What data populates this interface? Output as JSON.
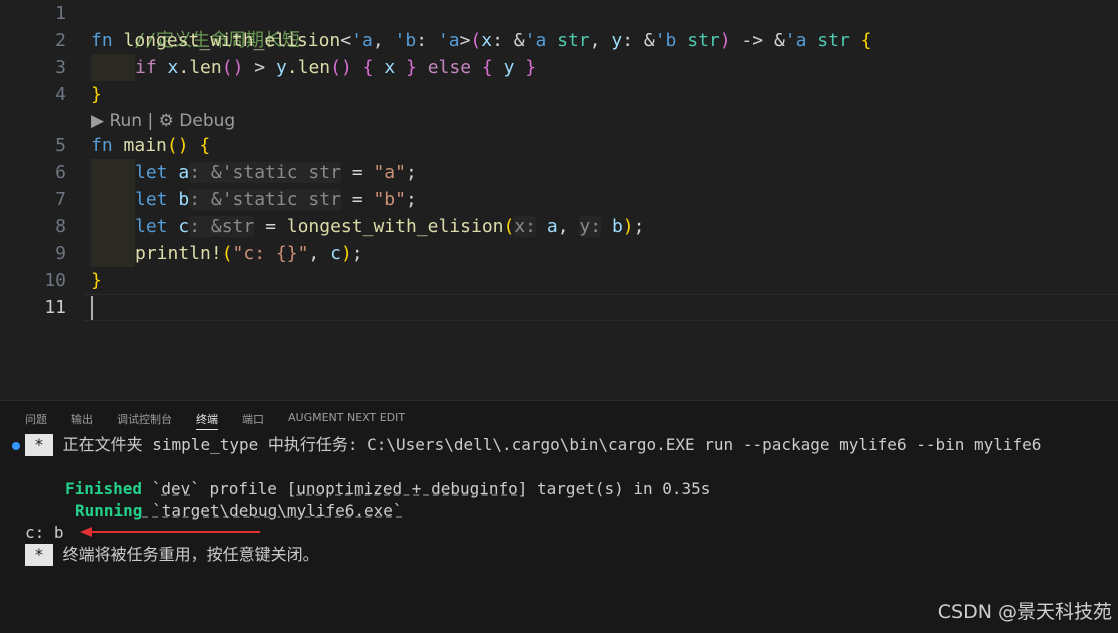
{
  "editor": {
    "line_numbers": [
      "1",
      "2",
      "3",
      "4",
      "5",
      "6",
      "7",
      "8",
      "9",
      "10",
      "11"
    ],
    "codelens": {
      "run": "▶ Run",
      "sep": " | ",
      "debug": "⚙ Debug"
    },
    "lines": {
      "l1": "//定义生命周期长短",
      "l2_fn": "fn",
      "l2_name": "longest_with_elision",
      "l2_rest_a": "<",
      "l2_lt_a": "'a",
      "l2_comma1": ", ",
      "l2_lt_b": "'b",
      "l2_colon": ": ",
      "l2_lt_a2": "'a",
      "l2_gt": ">",
      "l2_paren_open": "(",
      "l2_x": "x",
      "l2_xcolon": ": &",
      "l2_xlt": "'a",
      "l2_xty": " str",
      "l2_comma2": ", ",
      "l2_y": "y",
      "l2_ycolon": ": &",
      "l2_ylt": "'b",
      "l2_yty": " str",
      "l2_paren_close": ")",
      "l2_arrow": " -> &",
      "l2_rlt": "'a",
      "l2_rty": " str",
      "l2_brace": " {",
      "l3_if": "if",
      "l3_x": "x",
      "l3_len1": ".len",
      "l3_pp1": "()",
      "l3_gt": " > ",
      "l3_y": "y",
      "l3_len2": ".len",
      "l3_pp2": "()",
      "l3_b1": " { ",
      "l3_x2": "x",
      "l3_b2": " }",
      "l3_else": " else",
      "l3_b3": " { ",
      "l3_y2": "y",
      "l3_b4": " }",
      "l4": "}",
      "l5_fn": "fn",
      "l5_main": "main",
      "l5_pp": "()",
      "l5_brace": " {",
      "l6_let": "let",
      "l6_a": "a",
      "l6_hint": ": &'static str",
      "l6_eq": " = ",
      "l6_val": "\"a\"",
      "l6_semi": ";",
      "l7_let": "let",
      "l7_b": "b",
      "l7_hint": ": &'static str",
      "l7_eq": " = ",
      "l7_val": "\"b\"",
      "l7_semi": ";",
      "l8_let": "let",
      "l8_c": "c",
      "l8_hint": ": &str",
      "l8_eq": " = ",
      "l8_call": "longest_with_elision",
      "l8_po": "(",
      "l8_hx": "x:",
      "l8_a": "a",
      "l8_comma": ", ",
      "l8_hy": "y:",
      "l8_b": "b",
      "l8_pc": ")",
      "l8_semi": ";",
      "l9_mac": "println!",
      "l9_po": "(",
      "l9_str": "\"c: {}\"",
      "l9_comma": ", ",
      "l9_c": "c",
      "l9_pc": ")",
      "l9_semi": ";",
      "l10": "}"
    }
  },
  "panel": {
    "tabs": [
      "问题",
      "输出",
      "调试控制台",
      "终端",
      "端口",
      "AUGMENT NEXT EDIT"
    ],
    "active_tab": "终端",
    "terminal": {
      "star": "*",
      "task_line": "正在文件夹 simple_type 中执行任务: C:\\Users\\dell\\.cargo\\bin\\cargo.EXE run --package mylife6 --bin mylife6",
      "finished_label": "Finished",
      "finished_pre": " `",
      "finished_dev": "dev",
      "finished_mid": "` profile [",
      "finished_opt": "unoptimized + debuginfo",
      "finished_rest": "] target(s) in 0.35s",
      "running_label": "Running",
      "running_rest": " `target\\debug\\mylife6.exe`",
      "output": "c: b",
      "reuse_line": "终端将被任务重用，按任意键关闭。"
    }
  },
  "watermark": "CSDN @景天科技苑",
  "colors": {
    "accent": "#3794ff",
    "arrow": "#e03030",
    "green": "#23d18b"
  }
}
